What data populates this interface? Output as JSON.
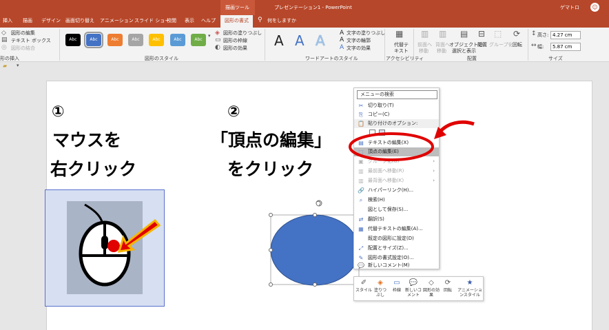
{
  "titlebar": {
    "context_group": "描画ツール",
    "doc_title": "プレゼンテーション1 - PowerPoint",
    "user": "ゲマトロ",
    "avatar_glyph": "☺"
  },
  "tabs": [
    "挿入",
    "描画",
    "デザイン",
    "画面切り替え",
    "アニメーション",
    "スライド ショー",
    "校閲",
    "表示",
    "ヘルプ"
  ],
  "active_tab": "図形の書式",
  "tell_me": "何をしますか",
  "ribbon": {
    "insert_shapes": {
      "edit_shape": "図形の編集",
      "text_box": "テキスト ボックス",
      "merge": "図形の結合",
      "label": "形の挿入"
    },
    "shape_styles": {
      "swatch_text": "Abc",
      "swatch_colors": [
        "#000000",
        "#4472c4",
        "#ed7d31",
        "#a5a5a5",
        "#ffc000",
        "#5b9bd5",
        "#70ad47"
      ],
      "fill": "図形の塗りつぶし",
      "outline": "図形の枠線",
      "effects": "図形の効果",
      "label": "図形のスタイル"
    },
    "wordart": {
      "letter": "A",
      "fill": "文字の塗りつぶし",
      "outline": "文字の輪郭",
      "effects": "文字の効果",
      "label": "ワードアートのスタイル"
    },
    "accessibility": {
      "alt_text_1": "代替テ",
      "alt_text_2": "キスト",
      "label": "アクセシビリティ"
    },
    "arrange": {
      "forward_1": "前面へ",
      "forward_2": "移動",
      "backward_1": "背面へ",
      "backward_2": "移動",
      "pane_1": "オブジェクトの",
      "pane_2": "選択と表示",
      "align": "配置",
      "group": "グループ化",
      "rotate": "回転",
      "label": "配置"
    },
    "size": {
      "height_label": "高さ:",
      "height": "4.27 cm",
      "width_label": "幅:",
      "width": "5.87 cm",
      "label": "サイズ"
    }
  },
  "slide": {
    "step1_num": "①",
    "step1_line1": "マウスを",
    "step1_line2": "右クリック",
    "step2_num": "②",
    "step2_line1": "「頂点の編集」",
    "step2_line2": "をクリック"
  },
  "context_menu": {
    "search": "メニューの検索",
    "items": [
      {
        "icon": "✂",
        "label": "切り取り(T)",
        "state": "normal"
      },
      {
        "icon": "⎘",
        "label": "コピー(C)",
        "state": "normal"
      },
      {
        "icon": "📋",
        "label": "貼り付けのオプション:",
        "state": "head"
      },
      {
        "icon": "",
        "label": "",
        "state": "paste"
      },
      {
        "icon": "▤",
        "label": "テキストの編集(X)",
        "state": "normal"
      },
      {
        "icon": "⬚",
        "label": "頂点の編集(E)",
        "state": "hl"
      },
      {
        "icon": "▣",
        "label": "グループ化(G)",
        "state": "dis"
      },
      {
        "icon": "▥",
        "label": "最前面へ移動(R)",
        "state": "dis"
      },
      {
        "icon": "▥",
        "label": "最背面へ移動(K)",
        "state": "dis"
      },
      {
        "icon": "🔗",
        "label": "ハイパーリンク(H)...",
        "state": "normal"
      },
      {
        "icon": "⌕",
        "label": "検索(H)",
        "state": "normal"
      },
      {
        "icon": "",
        "label": "図として保存(S)...",
        "state": "normal"
      },
      {
        "icon": "⇄",
        "label": "翻訳(S)",
        "state": "normal"
      },
      {
        "icon": "▦",
        "label": "代替テキストの編集(A)...",
        "state": "normal"
      },
      {
        "icon": "",
        "label": "既定の図形に設定(D)",
        "state": "normal"
      },
      {
        "icon": "⤢",
        "label": "配置とサイズ(Z)...",
        "state": "normal"
      },
      {
        "icon": "✎",
        "label": "図形の書式設定(O)...",
        "state": "normal"
      },
      {
        "icon": "💬",
        "label": "新しいコメント(M)",
        "state": "normal"
      }
    ]
  },
  "mini_toolbar": [
    {
      "icon": "✐",
      "label": "スタイル"
    },
    {
      "icon": "◈",
      "label": "塗りつぶし"
    },
    {
      "icon": "▭",
      "label": "枠線"
    },
    {
      "icon": "💬",
      "label": "新しいコメント"
    },
    {
      "icon": "◇",
      "label": "図形の効果"
    },
    {
      "icon": "⟳",
      "label": "回転"
    },
    {
      "icon": "★",
      "label": "アニメーションスタイル"
    }
  ],
  "colors": {
    "accent": "#b7472a",
    "ellipse_fill": "#4472c4",
    "annotation_red": "#e00000"
  }
}
